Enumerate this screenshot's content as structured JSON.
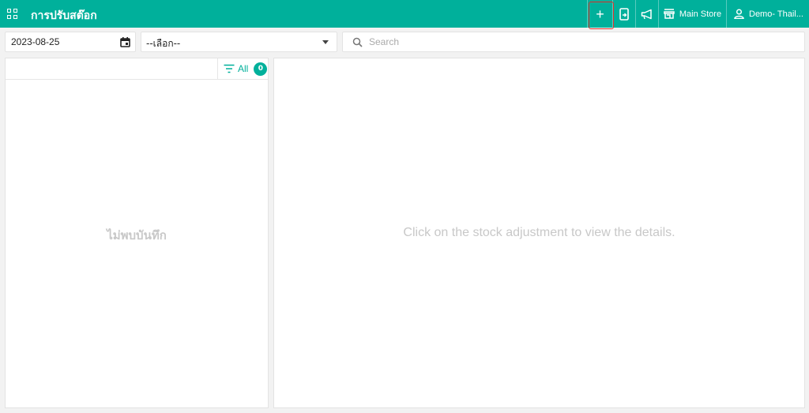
{
  "app": {
    "title": "การปรับสต๊อก"
  },
  "toolbar": {
    "store_label": "Main Store",
    "user_label": "Demo- Thail..."
  },
  "filters": {
    "date_value": "2023-08-25",
    "select_value": "--เลือก--",
    "search_placeholder": "Search"
  },
  "list": {
    "filter_label": "All",
    "count": "0",
    "empty_text": "ไม่พบบันทึก"
  },
  "detail": {
    "hint": "Click on the stock adjustment to view the details."
  },
  "colors": {
    "accent": "#00b09b",
    "highlight": "#e0302a"
  },
  "icons": [
    "apps-icon",
    "plus-icon",
    "mobile-export-icon",
    "megaphone-icon",
    "store-icon",
    "user-icon",
    "calendar-icon",
    "search-icon",
    "filter-icon"
  ]
}
